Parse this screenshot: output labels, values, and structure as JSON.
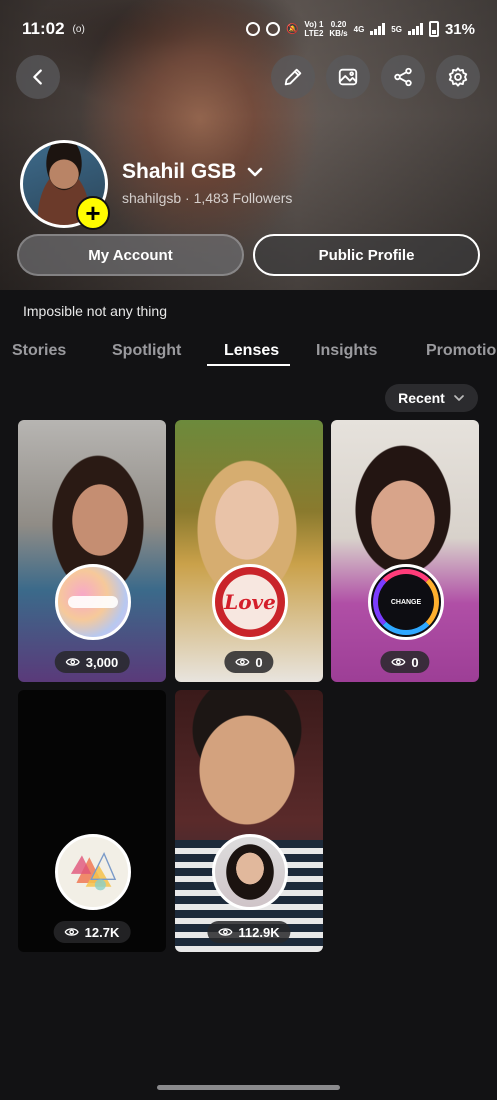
{
  "status_bar": {
    "time": "11:02",
    "rec": "(o)",
    "volte": "Vo) 1\nLTE2",
    "speed": "0.20\nKB/s",
    "net1": "4G",
    "net2": "5G",
    "battery": "31%"
  },
  "top_actions": [
    "back-icon",
    "pencil-icon",
    "image-icon",
    "share-icon",
    "gear-icon"
  ],
  "profile": {
    "display_name": "Shahil GSB",
    "username_line": "shahilgsb · 1,483 Followers",
    "bio": "Imposible not any thing"
  },
  "buttons": {
    "my_account": "My Account",
    "public_profile": "Public Profile"
  },
  "tabs": [
    {
      "label": "Stories"
    },
    {
      "label": "Spotlight"
    },
    {
      "label": "Lenses"
    },
    {
      "label": "Insights"
    },
    {
      "label": "Promotion"
    }
  ],
  "active_tab": "Lenses",
  "sort": {
    "label": "Recent"
  },
  "lenses": [
    {
      "views": "3,000"
    },
    {
      "views": "0",
      "icon_text": "Love"
    },
    {
      "views": "0",
      "icon_text": "CHANGE"
    },
    {
      "views": "12.7K"
    },
    {
      "views": "112.9K"
    }
  ],
  "colors": {
    "accent_yellow": "#fffc00",
    "background": "#121214"
  }
}
